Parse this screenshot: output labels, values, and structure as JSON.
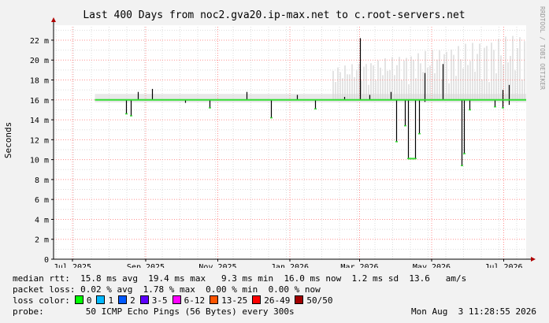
{
  "chart_data": {
    "type": "line",
    "title": "Last 400 Days from noc2.gva20.ip-max.net to c.root-servers.net",
    "ylabel": "Seconds",
    "xlabel": "",
    "watermark": "RRDTOOL / TOBI OETIKER",
    "ylim": [
      0,
      23.5
    ],
    "yticks": [
      0,
      2,
      4,
      6,
      8,
      10,
      12,
      14,
      16,
      18,
      20,
      22
    ],
    "ytick_labels": [
      "0",
      "2 m",
      "4 m",
      "6 m",
      "8 m",
      "10 m",
      "12 m",
      "14 m",
      "16 m",
      "18 m",
      "20 m",
      "22 m"
    ],
    "xlim": [
      "2025-06-29",
      "2026-08-03"
    ],
    "xticks": [
      {
        "date": "2025-07-15",
        "label": "Jul 2025"
      },
      {
        "date": "2025-09-15",
        "label": "Sep 2025"
      },
      {
        "date": "2025-11-15",
        "label": "Nov 2025"
      },
      {
        "date": "2026-01-15",
        "label": "Jan 2026"
      },
      {
        "date": "2026-03-15",
        "label": "Mar 2026"
      },
      {
        "date": "2026-05-15",
        "label": "May 2026"
      },
      {
        "date": "2026-07-15",
        "label": "Jul 2026"
      }
    ],
    "grid": true,
    "colors": {
      "background": "#ffffff",
      "canvas": "#f2f2f2",
      "major_grid": "#ff9090",
      "minor_grid": "#dddddd",
      "smoke": "#d8d8d8",
      "median": "#33dd33",
      "spike": "#000000"
    },
    "series": [
      {
        "name": "median rtt",
        "baseline_ms": 16.0,
        "start": "2025-08-03",
        "end": "2026-08-03",
        "events": [
          {
            "date": "2025-08-29",
            "min": 14.6,
            "max": 16.0
          },
          {
            "date": "2025-09-02",
            "min": 14.4,
            "max": 16.0
          },
          {
            "date": "2025-09-08",
            "min": 16.0,
            "max": 16.8
          },
          {
            "date": "2025-09-20",
            "min": 16.0,
            "max": 17.1
          },
          {
            "date": "2025-10-18",
            "min": 15.7,
            "max": 16.0
          },
          {
            "date": "2025-11-08",
            "min": 15.2,
            "max": 16.0
          },
          {
            "date": "2025-12-09",
            "min": 16.0,
            "max": 16.8
          },
          {
            "date": "2025-12-30",
            "min": 14.2,
            "max": 16.0
          },
          {
            "date": "2026-01-21",
            "min": 16.0,
            "max": 16.5
          },
          {
            "date": "2026-02-05",
            "min": 15.1,
            "max": 16.0
          },
          {
            "date": "2026-03-02",
            "min": 16.0,
            "max": 16.3
          },
          {
            "date": "2026-03-15",
            "min": 16.0,
            "max": 22.2
          },
          {
            "date": "2026-03-23",
            "min": 16.0,
            "max": 16.5
          },
          {
            "date": "2026-04-10",
            "min": 16.0,
            "max": 16.8
          },
          {
            "date": "2026-04-15",
            "min": 11.8,
            "max": 16.0
          },
          {
            "date": "2026-04-22",
            "min": 13.4,
            "max": 16.0
          },
          {
            "date": "2026-04-25",
            "min": 10.1,
            "max": 16.0
          },
          {
            "date": "2026-05-01",
            "min": 10.1,
            "max": 16.0
          },
          {
            "date": "2026-05-04",
            "min": 12.6,
            "max": 16.0
          },
          {
            "date": "2026-05-09",
            "min": 15.8,
            "max": 18.7
          },
          {
            "date": "2026-05-24",
            "min": 16.0,
            "max": 19.6
          },
          {
            "date": "2026-06-09",
            "min": 9.4,
            "max": 16.0
          },
          {
            "date": "2026-06-11",
            "min": 10.6,
            "max": 16.0
          },
          {
            "date": "2026-06-16",
            "min": 15.0,
            "max": 16.0
          },
          {
            "date": "2026-07-07",
            "min": 15.3,
            "max": 16.0
          },
          {
            "date": "2026-07-14",
            "min": 15.2,
            "max": 17.0
          },
          {
            "date": "2026-07-19",
            "min": 15.5,
            "max": 17.5
          }
        ]
      }
    ]
  },
  "legend": {
    "median_rtt": {
      "label": "median rtt:",
      "avg": "15.8 ms avg",
      "max": "19.4 ms max",
      "min": "9.3 ms min",
      "now": "16.0 ms now",
      "sd": "1.2 ms sd",
      "am": "13.6",
      "am_unit": "am/s"
    },
    "packet_loss": {
      "label": "packet loss:",
      "avg": "0.02 % avg",
      "max": "1.78 % max",
      "min": "0.00 % min",
      "now": "0.00 % now"
    },
    "loss_color": {
      "label": "loss color:",
      "items": [
        {
          "label": "0",
          "color": "#00ff00"
        },
        {
          "label": "1",
          "color": "#00b8ff"
        },
        {
          "label": "2",
          "color": "#0059ff"
        },
        {
          "label": "3-5",
          "color": "#5e00ff"
        },
        {
          "label": "6-12",
          "color": "#ff00ff"
        },
        {
          "label": "13-25",
          "color": "#ff5500"
        },
        {
          "label": "26-49",
          "color": "#ff0000"
        },
        {
          "label": "50/50",
          "color": "#a10000"
        }
      ]
    },
    "probe": {
      "label": "probe:",
      "text": "50 ICMP Echo Pings (56 Bytes) every 300s",
      "timestamp": "Mon Aug  3 11:28:55 2026"
    }
  }
}
